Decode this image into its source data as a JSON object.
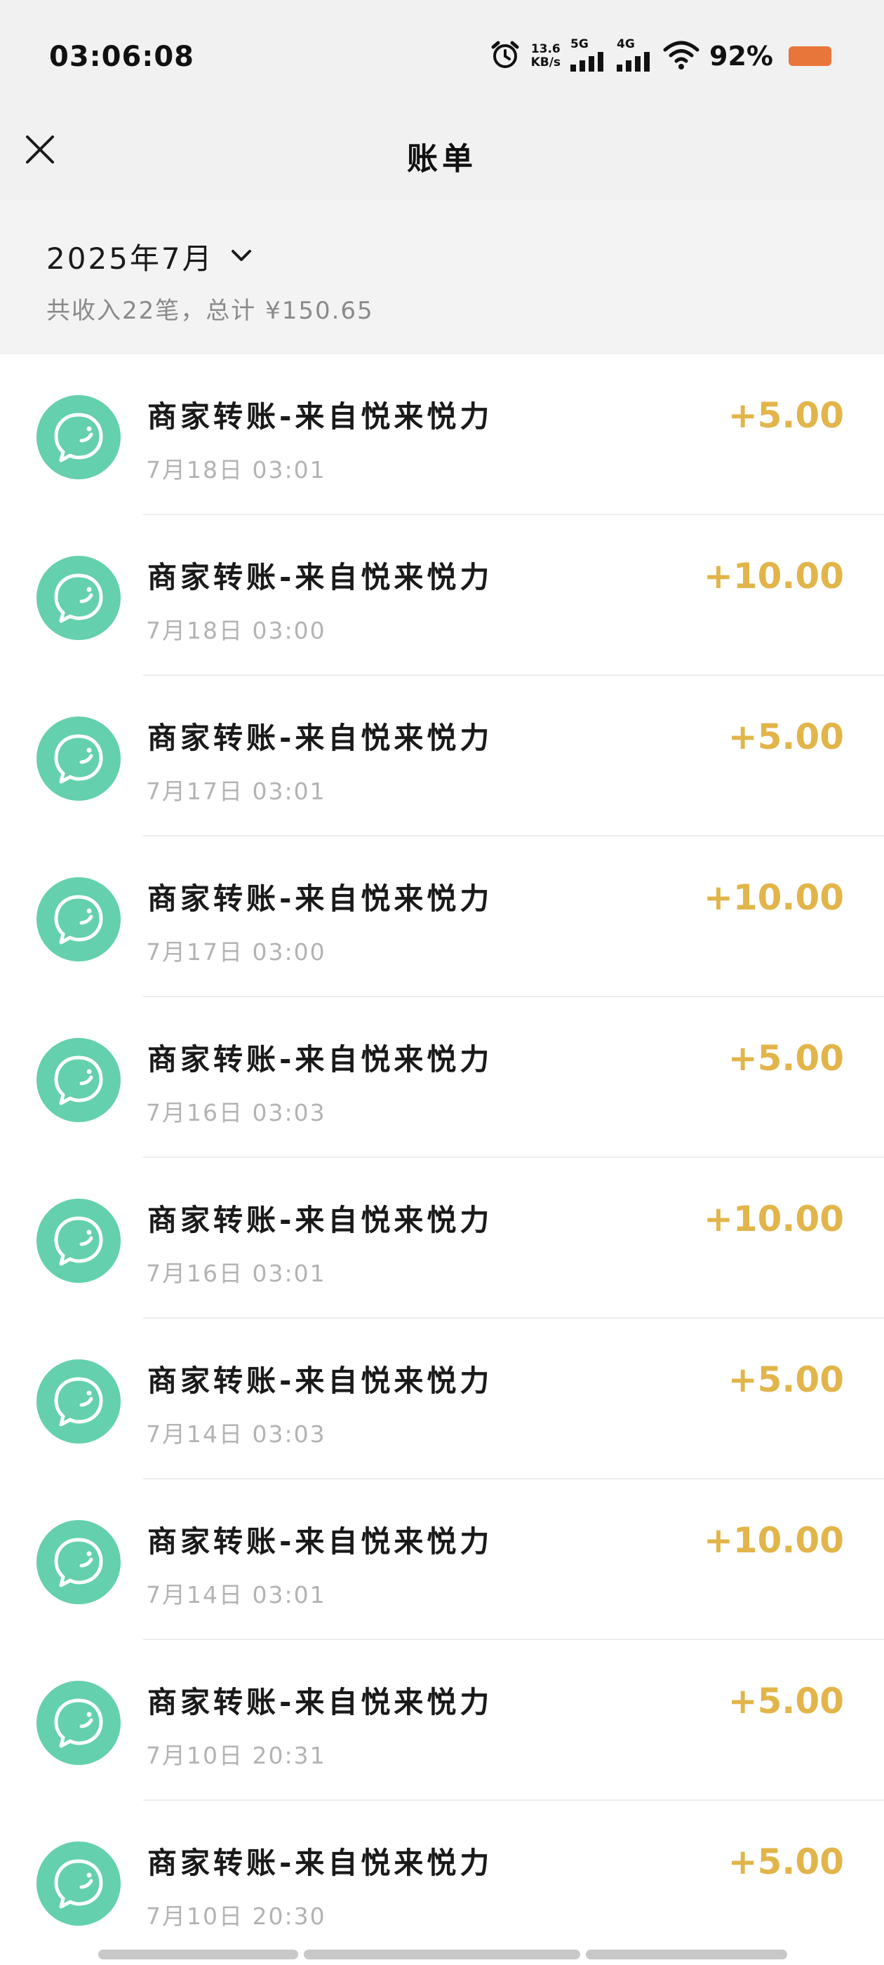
{
  "status_bar": {
    "time": "03:06:08",
    "net_speed_value": "13.6",
    "net_speed_unit": "KB/s",
    "signal_1_label": "5G",
    "signal_2_label": "4G",
    "battery_percent": "92%",
    "battery_level": 0.92,
    "battery_color": "#e8753a",
    "icons": [
      "alarm-icon",
      "signal-icon",
      "wifi-icon",
      "battery-icon"
    ]
  },
  "nav": {
    "title": "账单",
    "close_icon": "close-icon"
  },
  "summary": {
    "month": "2025年7月",
    "dropdown_icon": "chevron-down-icon",
    "text": "共收入22笔，总计 ¥150.65"
  },
  "colors": {
    "avatar": "#64d0ad",
    "amount": "#e2b54a",
    "header_bg": "#f1f1f1"
  },
  "transactions": [
    {
      "title": "商家转账-来自悦来悦力",
      "time": "7月18日 03:01",
      "amount": "+5.00"
    },
    {
      "title": "商家转账-来自悦来悦力",
      "time": "7月18日 03:00",
      "amount": "+10.00"
    },
    {
      "title": "商家转账-来自悦来悦力",
      "time": "7月17日 03:01",
      "amount": "+5.00"
    },
    {
      "title": "商家转账-来自悦来悦力",
      "time": "7月17日 03:00",
      "amount": "+10.00"
    },
    {
      "title": "商家转账-来自悦来悦力",
      "time": "7月16日 03:03",
      "amount": "+5.00"
    },
    {
      "title": "商家转账-来自悦来悦力",
      "time": "7月16日 03:01",
      "amount": "+10.00"
    },
    {
      "title": "商家转账-来自悦来悦力",
      "time": "7月14日 03:03",
      "amount": "+5.00"
    },
    {
      "title": "商家转账-来自悦来悦力",
      "time": "7月14日 03:01",
      "amount": "+10.00"
    },
    {
      "title": "商家转账-来自悦来悦力",
      "time": "7月10日 20:31",
      "amount": "+5.00"
    },
    {
      "title": "商家转账-来自悦来悦力",
      "time": "7月10日 20:30",
      "amount": "+5.00"
    }
  ]
}
